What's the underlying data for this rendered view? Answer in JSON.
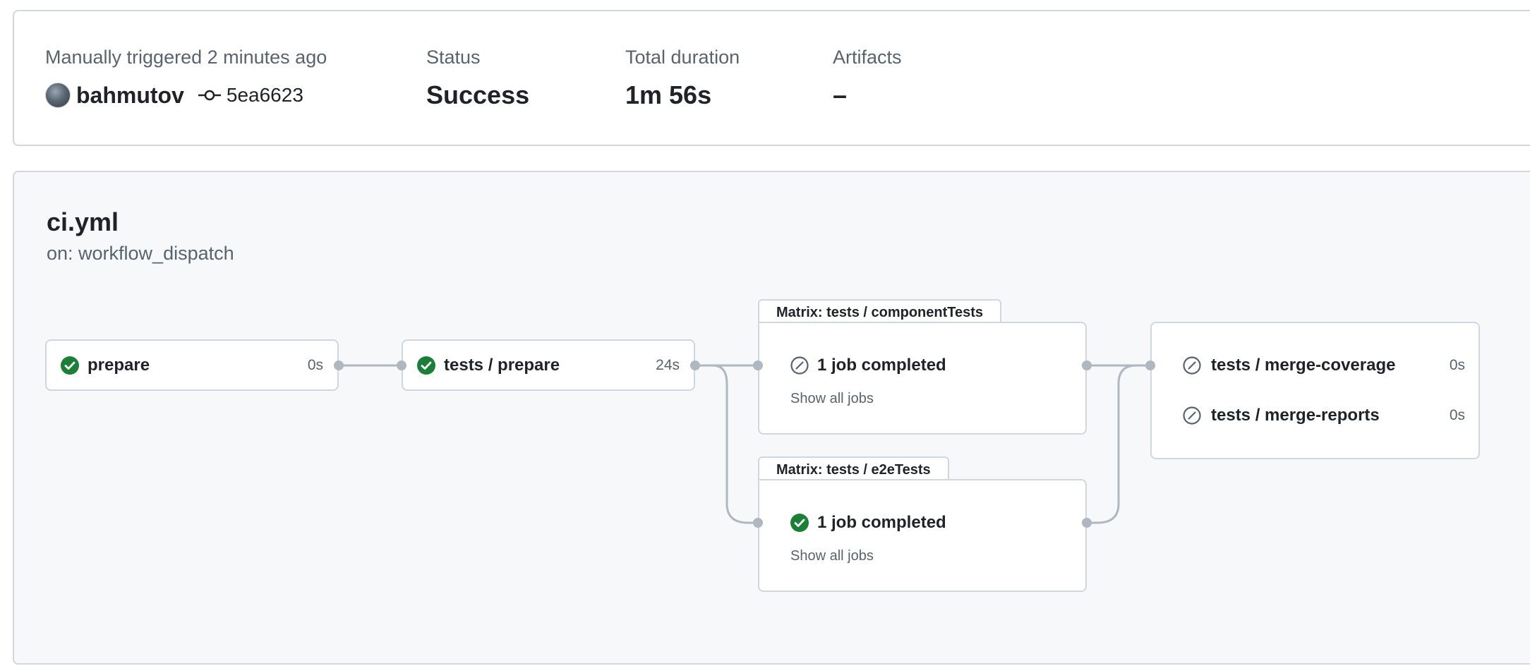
{
  "summary": {
    "trigger_label": "Manually triggered 2 minutes ago",
    "actor": "bahmutov",
    "commit_sha": "5ea6623",
    "status_label": "Status",
    "status_value": "Success",
    "duration_label": "Total duration",
    "duration_value": "1m 56s",
    "artifacts_label": "Artifacts",
    "artifacts_value": "–"
  },
  "workflow": {
    "file": "ci.yml",
    "trigger": "on: workflow_dispatch"
  },
  "jobs": {
    "prepare": {
      "name": "prepare",
      "duration": "0s",
      "status": "success"
    },
    "tests_prepare": {
      "name": "tests / prepare",
      "duration": "24s",
      "status": "success"
    },
    "matrix_component": {
      "title": "Matrix: tests / componentTests",
      "summary": "1 job completed",
      "status": "skipped",
      "show_all": "Show all jobs"
    },
    "matrix_e2e": {
      "title": "Matrix: tests / e2eTests",
      "summary": "1 job completed",
      "status": "success",
      "show_all": "Show all jobs"
    },
    "merge_group": [
      {
        "name": "tests / merge-coverage",
        "duration": "0s",
        "status": "skipped"
      },
      {
        "name": "tests / merge-reports",
        "duration": "0s",
        "status": "skipped"
      }
    ]
  },
  "colors": {
    "success": "#1a7f37",
    "skipped": "#59636e",
    "connector": "#afb8c1",
    "border": "#d0d7de"
  }
}
